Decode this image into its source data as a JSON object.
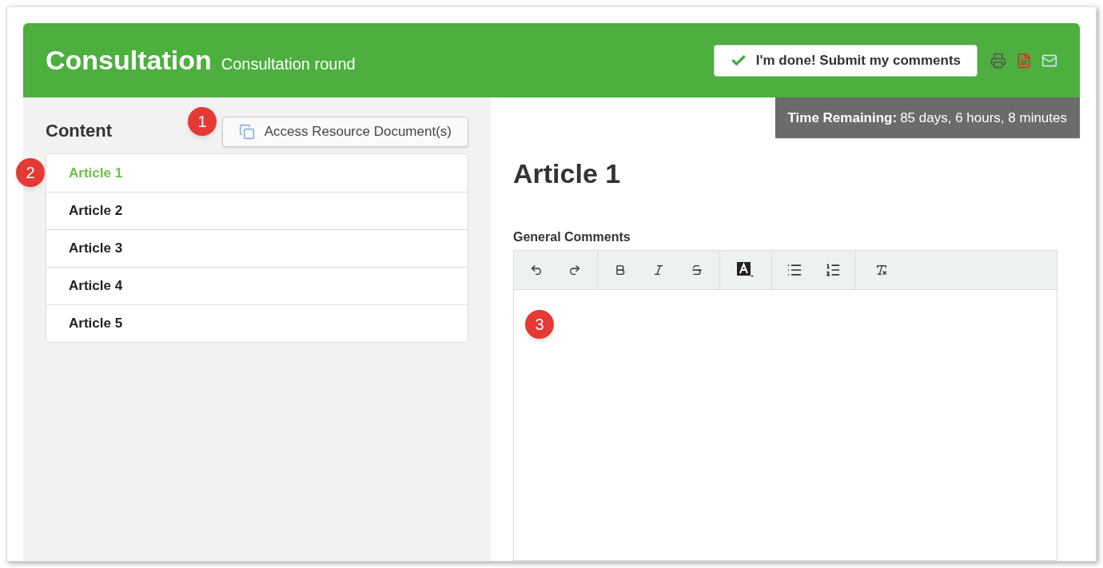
{
  "header": {
    "title": "Consultation",
    "subtitle": "Consultation round",
    "submit_button": "I'm done! Submit my comments"
  },
  "timer": {
    "label": "Time Remaining:",
    "value": "85 days, 6 hours, 8 minutes"
  },
  "sidebar": {
    "heading": "Content",
    "resource_button": "Access Resource Document(s)",
    "items": [
      {
        "label": "Article 1",
        "selected": true
      },
      {
        "label": "Article 2",
        "selected": false
      },
      {
        "label": "Article 3",
        "selected": false
      },
      {
        "label": "Article 4",
        "selected": false
      },
      {
        "label": "Article 5",
        "selected": false
      }
    ]
  },
  "article": {
    "title": "Article 1",
    "field_label": "General Comments"
  },
  "callouts": [
    "1",
    "2",
    "3"
  ]
}
